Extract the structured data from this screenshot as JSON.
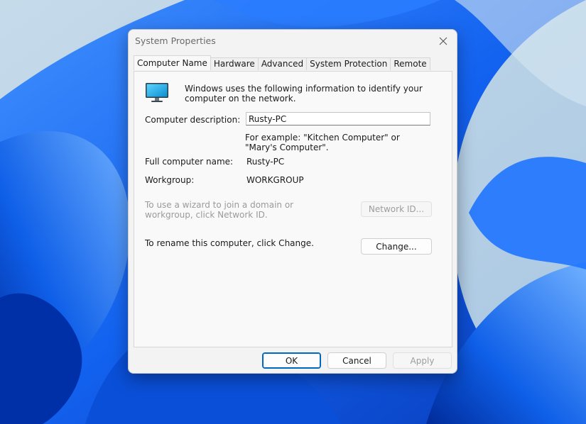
{
  "window": {
    "title": "System Properties",
    "close_icon": "close-icon"
  },
  "tabs": [
    {
      "label": "Computer Name",
      "active": true
    },
    {
      "label": "Hardware",
      "active": false
    },
    {
      "label": "Advanced",
      "active": false
    },
    {
      "label": "System Protection",
      "active": false
    },
    {
      "label": "Remote",
      "active": false
    }
  ],
  "computer_name_tab": {
    "icon": "monitor-icon",
    "intro_text": "Windows uses the following information to identify your computer on the network.",
    "description_label": "Computer description:",
    "description_value": "Rusty-PC",
    "example_text": "For example: \"Kitchen Computer\" or \"Mary's Computer\".",
    "full_name_label": "Full computer name:",
    "full_name_value": "Rusty-PC",
    "workgroup_label": "Workgroup:",
    "workgroup_value": "WORKGROUP",
    "network_id_text": "To use a wizard to join a domain or workgroup, click Network ID.",
    "network_id_button": "Network ID...",
    "rename_text": "To rename this computer, click Change.",
    "change_button": "Change..."
  },
  "footer": {
    "ok_label": "OK",
    "cancel_label": "Cancel",
    "apply_label": "Apply"
  },
  "colors": {
    "accent": "#0067c0",
    "wallpaper_blue": "#0a5cf0"
  }
}
